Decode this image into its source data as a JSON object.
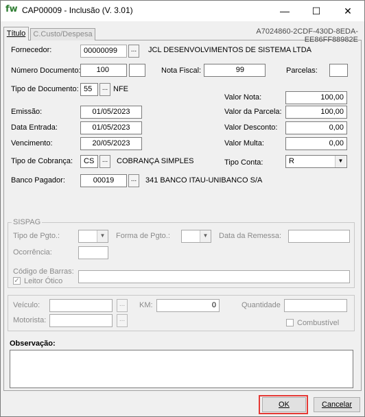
{
  "window": {
    "logo": "fw",
    "title": "CAP00009 - Inclusão   (V. 3.01)",
    "minimize": "—",
    "maximize": "☐",
    "close": "✕"
  },
  "tabs": [
    {
      "label": "Título"
    },
    {
      "label": "C.Custo/Despesa"
    }
  ],
  "record_id": "A7024860-2CDF-430D-8EDA-EE86FF88982E",
  "form": {
    "fornecedor": {
      "label": "Fornecedor:",
      "code": "00000099",
      "name": "JCL DESENVOLVIMENTOS DE SISTEMA LTDA"
    },
    "numero_documento": {
      "label": "Número Documento:",
      "value": "100",
      "extra": ""
    },
    "nota_fiscal": {
      "label": "Nota Fiscal:",
      "value": "99"
    },
    "parcelas": {
      "label": "Parcelas:",
      "value": ""
    },
    "tipo_documento": {
      "label": "Tipo de Documento:",
      "code": "55",
      "name": "NFE"
    },
    "valor_nota": {
      "label": "Valor Nota:",
      "value": "100,00"
    },
    "emissao": {
      "label": "Emissão:",
      "value": "01/05/2023"
    },
    "valor_parcela": {
      "label": "Valor da Parcela:",
      "value": "100,00"
    },
    "data_entrada": {
      "label": "Data Entrada:",
      "value": "01/05/2023"
    },
    "valor_desconto": {
      "label": "Valor Desconto:",
      "value": "0,00"
    },
    "vencimento": {
      "label": "Vencimento:",
      "value": "20/05/2023"
    },
    "valor_multa": {
      "label": "Valor Multa:",
      "value": "0,00"
    },
    "tipo_cobranca": {
      "label": "Tipo de Cobrança:",
      "code": "CS",
      "name": "COBRANÇA SIMPLES"
    },
    "tipo_conta": {
      "label": "Tipo Conta:",
      "value": "R"
    },
    "banco_pagador": {
      "label": "Banco Pagador:",
      "code": "00019",
      "name": "341  BANCO ITAU-UNIBANCO S/A"
    }
  },
  "sispag": {
    "legend": "SISPAG",
    "tipo_pgto": {
      "label": "Tipo de Pgto.:",
      "value": ""
    },
    "forma_pgto": {
      "label": "Forma de Pgto.:",
      "value": ""
    },
    "data_remessa": {
      "label": "Data da Remessa:",
      "value": ""
    },
    "ocorrencia": {
      "label": "Ocorrência:",
      "value": ""
    },
    "codigo_barras": {
      "label": "Código de Barras:",
      "value": ""
    },
    "leitor_otico": {
      "label": "Leitor Ótico",
      "checked": true
    }
  },
  "veiculo_group": {
    "veiculo": {
      "label": "Veículo:",
      "value": ""
    },
    "km": {
      "label": "KM:",
      "value": "0"
    },
    "quantidade": {
      "label": "Quantidade",
      "value": ""
    },
    "motorista": {
      "label": "Motorista:",
      "value": ""
    },
    "combustivel": {
      "label": "Combustível",
      "checked": false
    }
  },
  "observacao": {
    "label": "Observação:",
    "value": ""
  },
  "buttons": {
    "ok": "OK",
    "cancel": "Cancelar"
  },
  "icons": {
    "ellipsis": "...",
    "dropdown": "▼",
    "check": "✓"
  }
}
